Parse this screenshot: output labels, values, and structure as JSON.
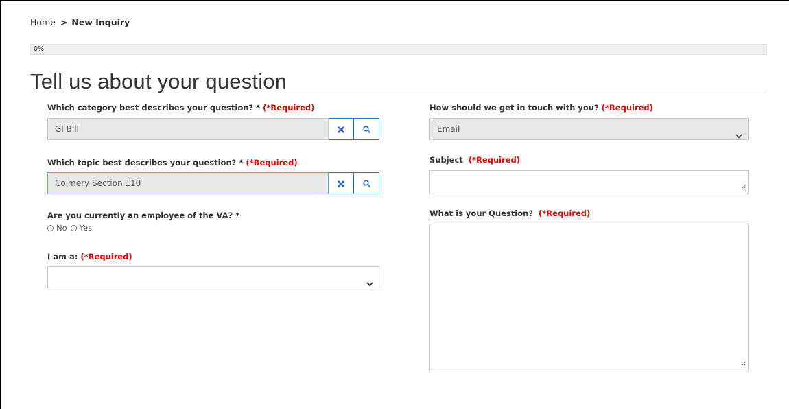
{
  "breadcrumb": {
    "home": "Home",
    "separator": ">",
    "current": "New Inquiry"
  },
  "progress": {
    "label": "0%",
    "value": 0
  },
  "page_title": "Tell us about your question",
  "form": {
    "category": {
      "label": "Which category best describes your question? *",
      "required_text": "(*Required)",
      "value": "GI Bill",
      "clear_icon": "close-icon",
      "search_icon": "search-icon"
    },
    "topic": {
      "label": "Which topic best describes your question? *",
      "required_text": "(*Required)",
      "value": "Colmery Section 110",
      "clear_icon": "close-icon",
      "search_icon": "search-icon"
    },
    "employee": {
      "label": "Are you currently an employee of the VA? *",
      "options": [
        "No",
        "Yes"
      ]
    },
    "i_am": {
      "label": "I am a:",
      "required_text": "(*Required)",
      "value": ""
    },
    "contact_method": {
      "label": "How should we get in touch with you?",
      "required_text": "(*Required)",
      "value": "Email"
    },
    "subject": {
      "label": "Subject",
      "required_text": "(*Required)",
      "value": ""
    },
    "question": {
      "label": "What is your Question?",
      "required_text": "(*Required)",
      "value": ""
    }
  },
  "colors": {
    "accent": "#2d6cb5",
    "required": "#e20000",
    "readonly_bg": "#e8e8e8"
  }
}
